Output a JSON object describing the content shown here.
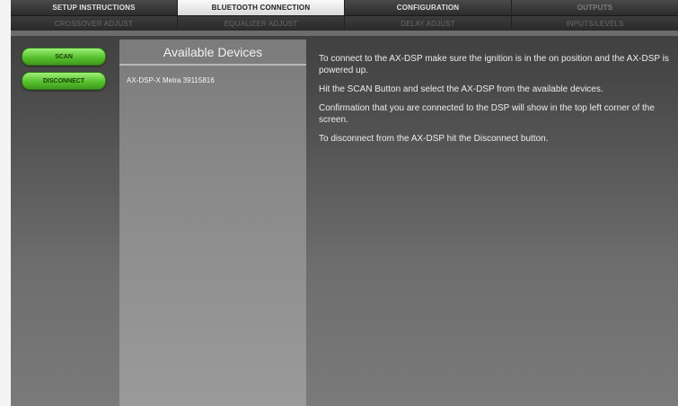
{
  "tabs_top": [
    {
      "label": "SETUP INSTRUCTIONS",
      "state": "normal"
    },
    {
      "label": "BLUETOOTH CONNECTION",
      "state": "active"
    },
    {
      "label": "CONFIGURATION",
      "state": "normal"
    },
    {
      "label": "OUTPUTS",
      "state": "dim"
    }
  ],
  "tabs_sub": [
    {
      "label": "CROSSOVER ADJUST"
    },
    {
      "label": "EQUALIZER ADJUST"
    },
    {
      "label": "DELAY ADJUST"
    },
    {
      "label": "INPUTS/LEVELS"
    }
  ],
  "buttons": {
    "scan_label": "SCAN",
    "disconnect_label": "DISCONNECT"
  },
  "devices": {
    "title": "Available Devices",
    "items": [
      "AX-DSP-X Metra 39115816"
    ]
  },
  "instructions": [
    "To connect to the AX-DSP make sure the ignition is in the on position and the AX-DSP is powered up.",
    "Hit the SCAN Button and select the AX-DSP from the available devices.",
    "Confirmation that you are connected to the DSP will show in the top left corner of the screen.",
    "To disconnect from the AX-DSP hit the Disconnect button."
  ],
  "colors": {
    "button_green": "#57c22e",
    "active_tab": "#f0f0f0",
    "panel_bg": "#4d4d4d"
  }
}
